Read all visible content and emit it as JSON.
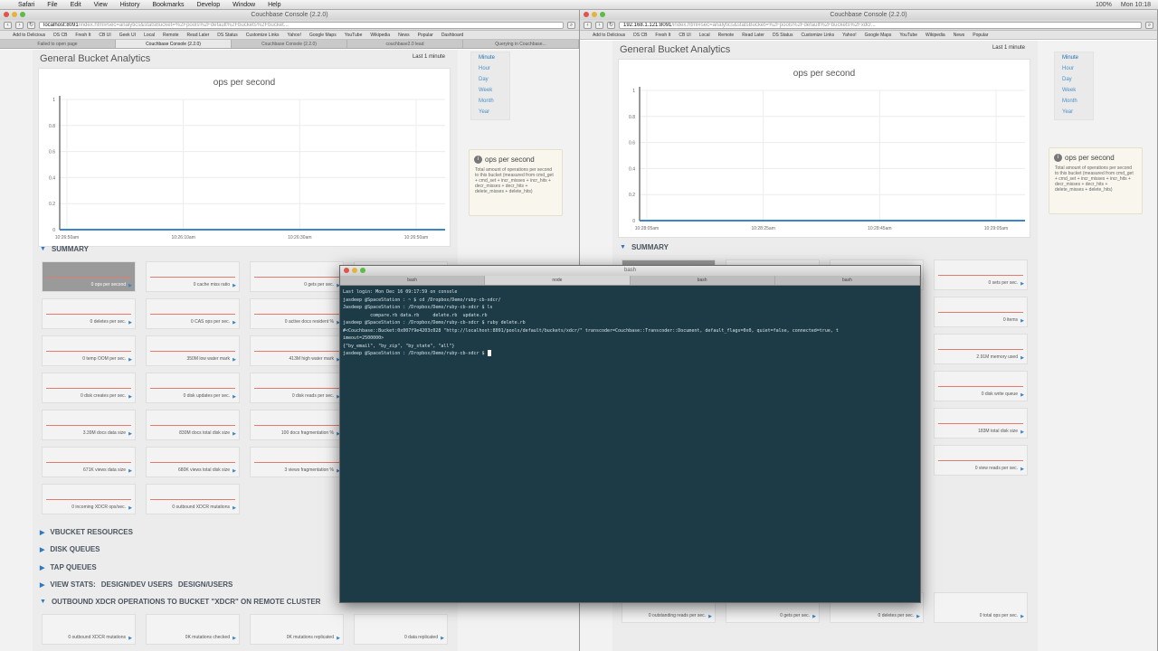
{
  "menubar": {
    "items": [
      "Safari",
      "File",
      "Edit",
      "View",
      "History",
      "Bookmarks",
      "Develop",
      "Window",
      "Help"
    ],
    "status": [
      "100%",
      "Mon 10:18"
    ]
  },
  "left_window": {
    "title": "Couchbase Console (2.2.0)",
    "url_host": "localhost:8091",
    "url_rest": "/index.html#sec=analytics&statsBucket=%2Fpools%2Fdefault%2Fbuckets%2Fbucket...",
    "bookmarks": [
      "Add to Delicious",
      "DS CB",
      "Fresh It",
      "CB UI",
      "Geek UI",
      "Local",
      "Remote",
      "Read Later",
      "DS Status",
      "Customize Links",
      "Yahoo!",
      "Google Maps",
      "YouTube",
      "Wikipedia",
      "News",
      "Popular",
      "Dashboard"
    ],
    "tabs": [
      "Failed to open page",
      "Couchbase Console (2.2.0)",
      "Couchbase Console (2.2.0)",
      "couchbase2.0 lead",
      "Querying in Couchbase..."
    ],
    "panel_title": "General Bucket Analytics",
    "last_minute": "Last 1 minute",
    "chart_title": "ops per second",
    "y_ticks": [
      "1",
      "0.8",
      "0.6",
      "0.4",
      "0.2",
      "0"
    ],
    "x_ticks": [
      "10:26:50am",
      "10:26:10am",
      "10:26:30am",
      "10:26:50am"
    ],
    "zoom": [
      "Minute",
      "Hour",
      "Day",
      "Week",
      "Month",
      "Year"
    ],
    "info_title": "ops per second",
    "info_desc": "Total amount of operations per second to this bucket (measured from cmd_get + cmd_set + incr_misses + incr_hits + decr_misses + decr_hits + delete_misses + delete_hits)",
    "summary": "SUMMARY",
    "tiles": [
      [
        "0 ops per second",
        "0 cache miss ratio",
        "0 gets per sec.",
        ""
      ],
      [
        "0 deletes per sec.",
        "0 CAS ops per sec.",
        "0 active docs resident %",
        ""
      ],
      [
        "0 temp OOM per sec.",
        "350M low water mark",
        "413M high water mark",
        ""
      ],
      [
        "0 disk creates per sec.",
        "0 disk updates per sec.",
        "0 disk reads per sec.",
        ""
      ],
      [
        "3.39M docs data size",
        "830M docs total disk size",
        "100 docs fragmentation %",
        ""
      ],
      [
        "671K views data size",
        "680K views total disk size",
        "3 views fragmentation %",
        ""
      ],
      [
        "0 incoming XDCR ops/sec.",
        "0 outbound XDCR mutations",
        "",
        ""
      ]
    ],
    "sections": [
      "VBUCKET RESOURCES",
      "DISK QUEUES",
      "TAP QUEUES",
      "VIEW STATS:",
      "DESIGN/DEV USERS",
      "DESIGN/USERS",
      "OUTBOUND XDCR OPERATIONS TO BUCKET \"XDCR\" ON REMOTE CLUSTER"
    ],
    "bottom_tiles": [
      "0 outbound XDCR mutations",
      "0K mutations checked",
      "0K mutations replicated",
      "0 data replicated"
    ]
  },
  "right_window": {
    "title": "Couchbase Console (2.2.0)",
    "url_host": "192.168.1.121:8091",
    "url_rest": "/index.html#sec=analytics&statsBucket=%2Fpools%2Fdefault%2Fbuckets%2Fxdcr...",
    "bookmarks": [
      "Add to Delicious",
      "DS CB",
      "Fresh It",
      "CB UI",
      "Local",
      "Remote",
      "Read Later",
      "DS Status",
      "Customize Links",
      "Yahoo!",
      "Google Maps",
      "YouTube",
      "Wikipedia",
      "News",
      "Popular"
    ],
    "panel_title": "General Bucket Analytics",
    "last_minute": "Last 1 minute",
    "chart_title": "ops per second",
    "y_ticks": [
      "1",
      "0.8",
      "0.6",
      "0.4",
      "0.2",
      "0"
    ],
    "x_ticks": [
      "10:28:05am",
      "10:28:25am",
      "10:28:45am",
      "10:29:05am"
    ],
    "zoom": [
      "Minute",
      "Hour",
      "Day",
      "Week",
      "Month",
      "Year"
    ],
    "info_title": "ops per second",
    "info_desc": "Total amount of operations per second to this bucket (measured from cmd_get + cmd_set + incr_misses + incr_hits + decr_misses + decr_hits + delete_misses + delete_hits)",
    "summary": "SUMMARY",
    "side_tiles": [
      "0 sets per sec.",
      "0 items",
      "2.91M memory used",
      "0 disk write queue",
      "183M total disk size",
      "0 view reads per sec."
    ],
    "bottom_tiles": [
      "0 outstanding reads per sec.",
      "0 gets per sec.",
      "0 deletes per sec.",
      "0 total ops per sec."
    ]
  },
  "terminal": {
    "title": "bash",
    "tabs": [
      "bash",
      "node",
      "bash",
      "bash"
    ],
    "lines": [
      "Last login: Mon Dec 16 09:17:59 on console",
      "jasdeep @SpaceStation : ~ $ cd /Dropbox/Demo/ruby-cb-xdcr/",
      "Jasdeep @SpaceStation : /Dropbox/Demo/ruby-cb-xdcr $ ls",
      "          compare.rb data.rb     delete.rb  update.rb",
      "jasdeep @SpaceStation : /Dropbox/Demo/ruby-cb-xdcr $ ruby delete.rb",
      "#<Couchbase::Bucket:0x007f9e4203c028 \"http://localhost:8091/pools/default/buckets/xdcr/\" transcoder=Couchbase::Transcoder::Document, default_flags=0x0, quiet=false, connected=true, t",
      "imeout=2500000>",
      "{\"by_email\", \"by_zip\", \"by_state\", \"all\"}",
      "jasdeep @SpaceStation : /Dropbox/Demo/ruby-cb-xdcr $ "
    ]
  }
}
